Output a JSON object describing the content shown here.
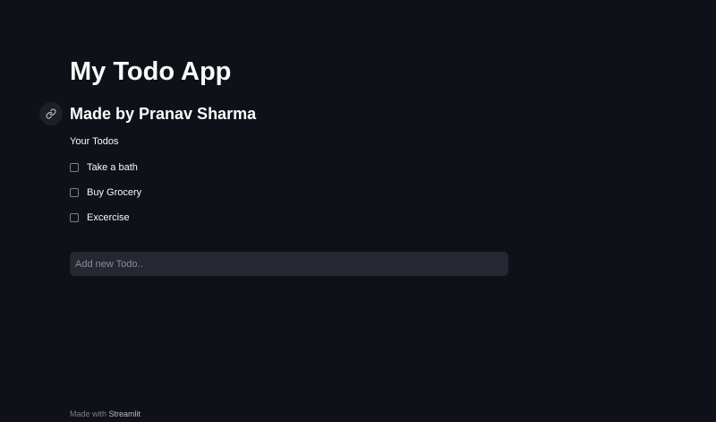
{
  "app": {
    "title": "My Todo App",
    "subtitle": "Made by Pranav Sharma",
    "caption": "Your Todos"
  },
  "todos": [
    {
      "label": "Take a bath",
      "checked": false
    },
    {
      "label": "Buy Grocery",
      "checked": false
    },
    {
      "label": "Excercise",
      "checked": false
    }
  ],
  "new_todo": {
    "value": "",
    "placeholder": "Add new Todo.."
  },
  "footer": {
    "prefix": "Made with ",
    "brand": "Streamlit"
  },
  "icons": {
    "anchor": "link-icon",
    "checkbox": "checkbox-unchecked-icon"
  },
  "colors": {
    "background": "#0e1117",
    "text": "#fafafa",
    "input_background": "#262730",
    "muted": "#7d808a"
  }
}
